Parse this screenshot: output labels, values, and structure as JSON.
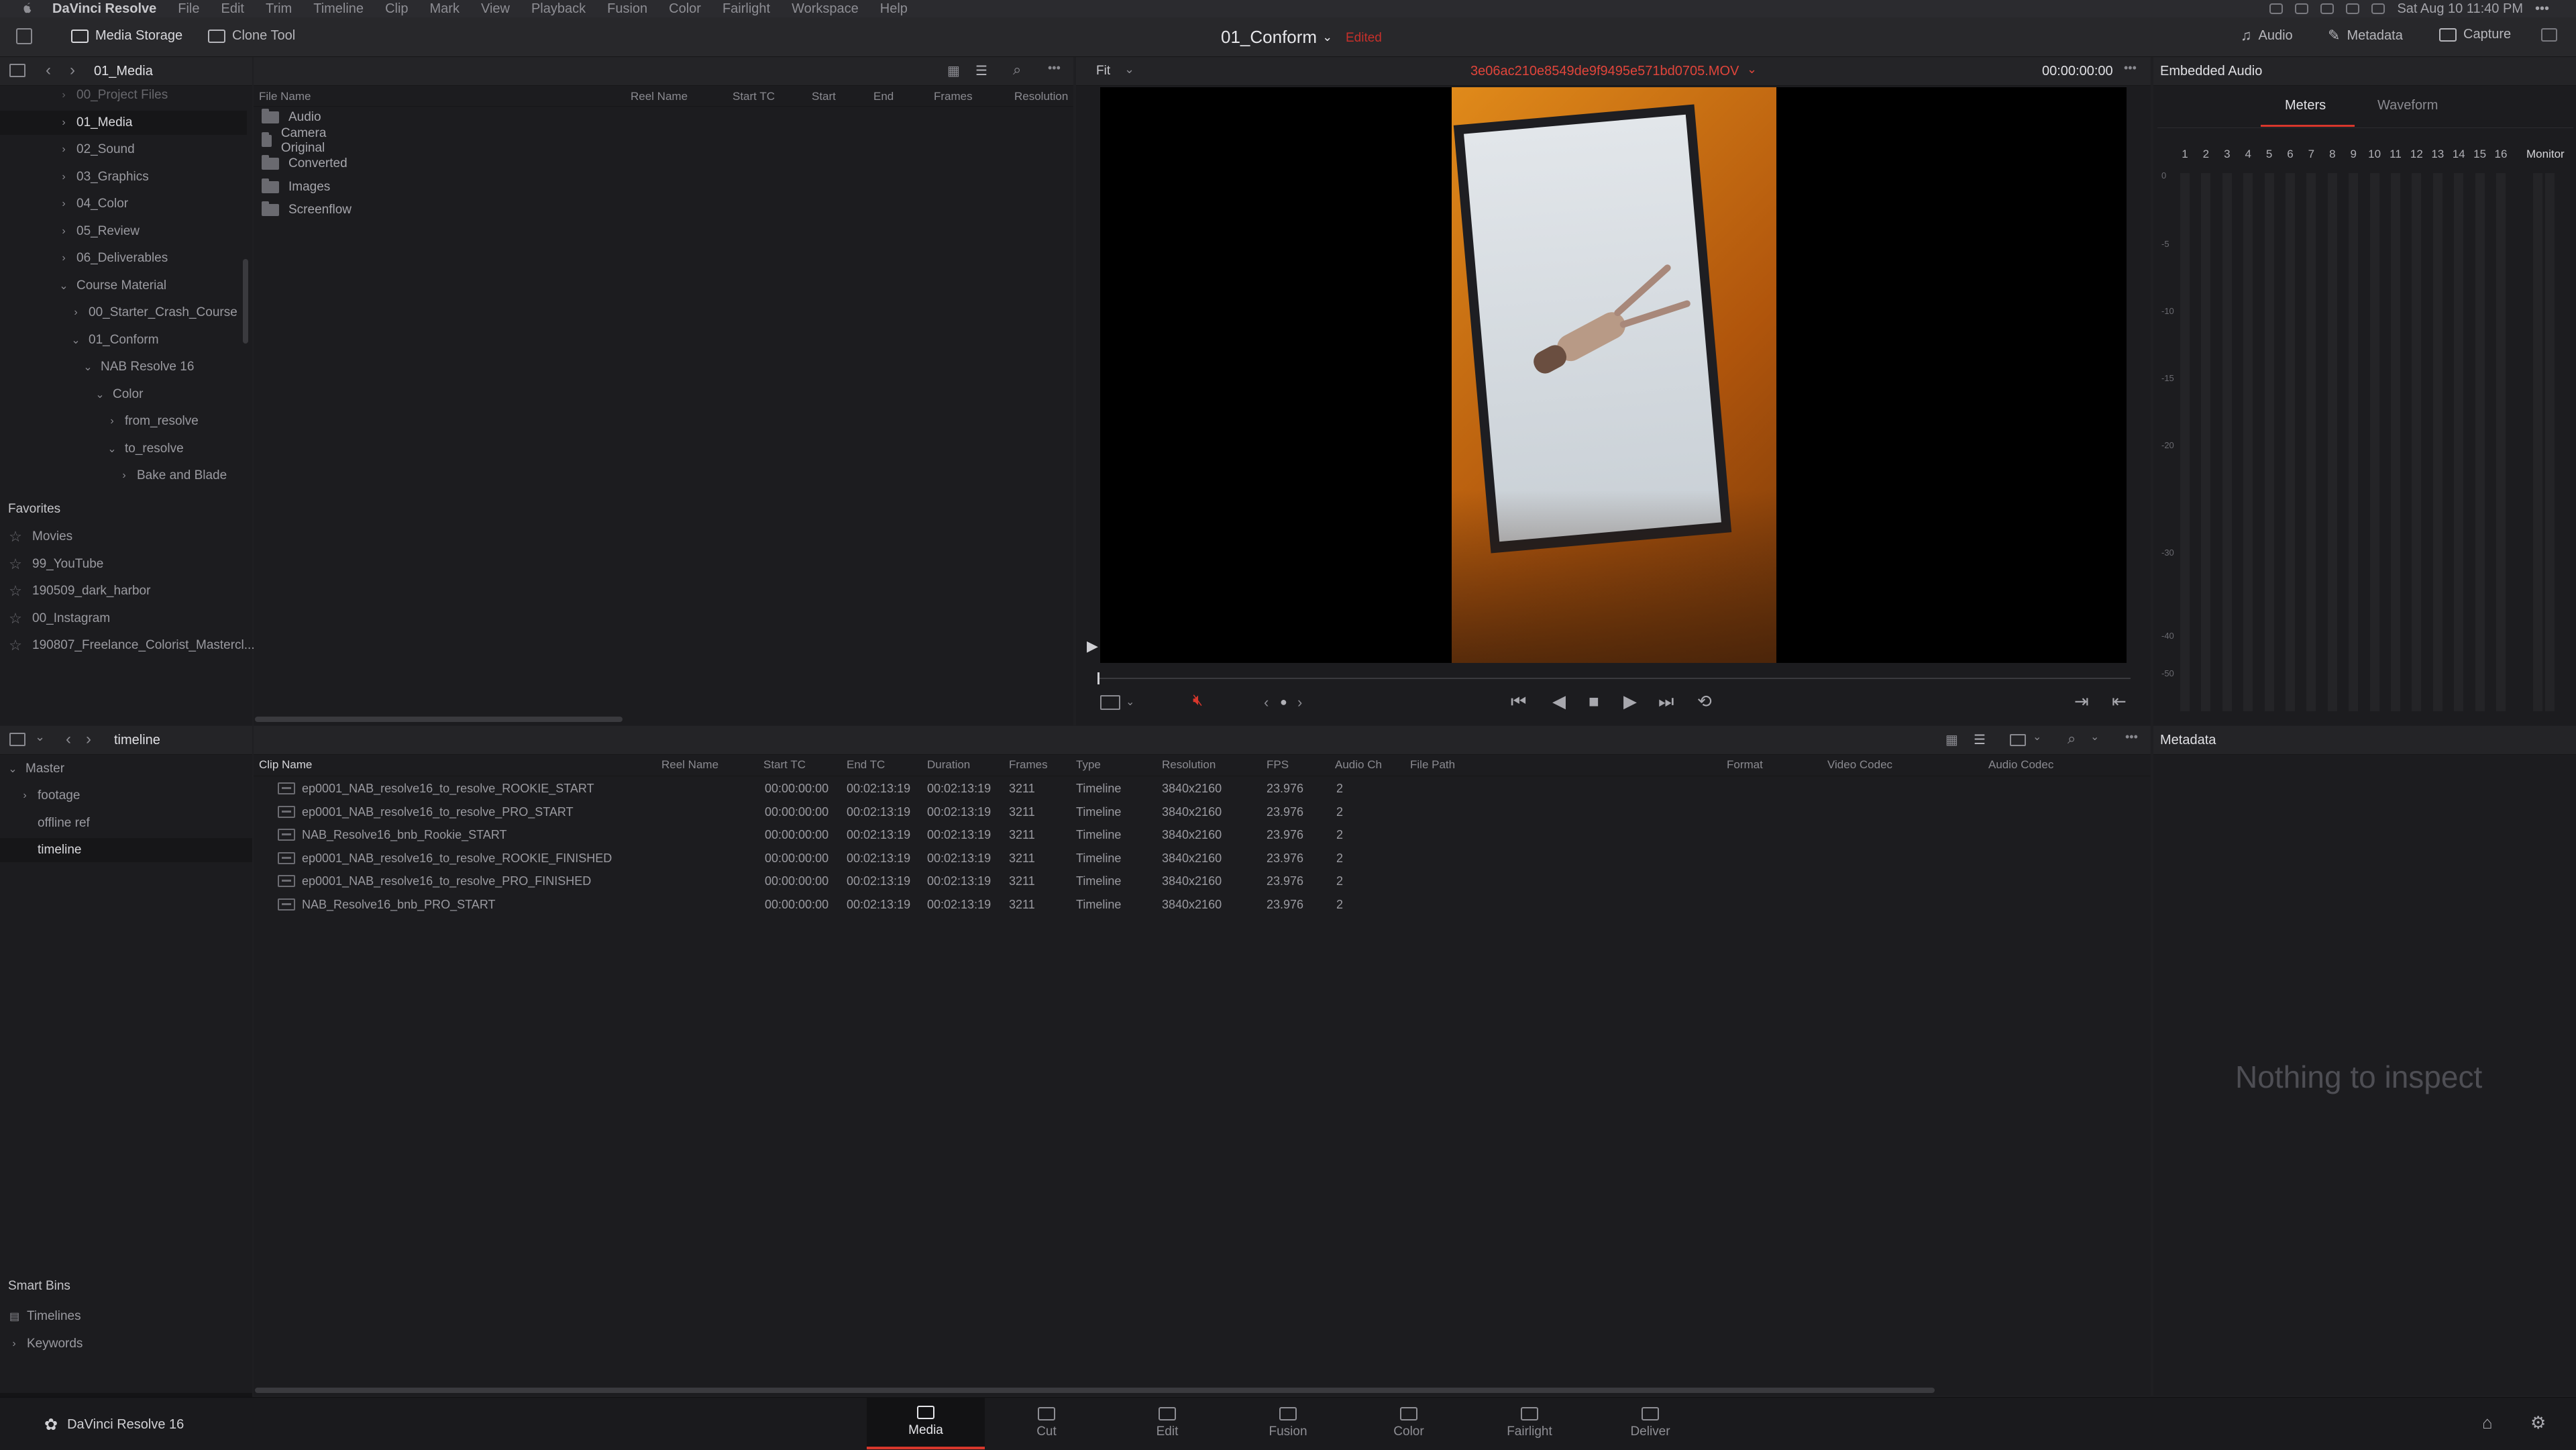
{
  "menubar": {
    "app_name": "DaVinci Resolve",
    "items": [
      "File",
      "Edit",
      "Trim",
      "Timeline",
      "Clip",
      "Mark",
      "View",
      "Playback",
      "Fusion",
      "Color",
      "Fairlight",
      "Workspace",
      "Help"
    ],
    "clock": "Sat Aug 10  11:40 PM"
  },
  "topbar": {
    "media_storage": "Media Storage",
    "clone_tool": "Clone Tool",
    "project_title": "01_Conform",
    "project_status": "Edited",
    "audio": "Audio",
    "metadata": "Metadata",
    "capture": "Capture"
  },
  "media_storage": {
    "path": "01_Media",
    "tree": [
      {
        "label": "00_Project Files",
        "depth": 0,
        "chev": "›",
        "cut": true
      },
      {
        "label": "01_Media",
        "depth": 0,
        "chev": "›",
        "selected": true
      },
      {
        "label": "02_Sound",
        "depth": 0,
        "chev": "›"
      },
      {
        "label": "03_Graphics",
        "depth": 0,
        "chev": "›"
      },
      {
        "label": "04_Color",
        "depth": 0,
        "chev": "›"
      },
      {
        "label": "05_Review",
        "depth": 0,
        "chev": "›"
      },
      {
        "label": "06_Deliverables",
        "depth": 0,
        "chev": "›"
      },
      {
        "label": "Course Material",
        "depth": 0,
        "chev": "⌄"
      },
      {
        "label": "00_Starter_Crash_Course",
        "depth": 1,
        "chev": "›"
      },
      {
        "label": "01_Conform",
        "depth": 1,
        "chev": "⌄"
      },
      {
        "label": "NAB Resolve 16",
        "depth": 2,
        "chev": "⌄"
      },
      {
        "label": "Color",
        "depth": 3,
        "chev": "⌄"
      },
      {
        "label": "from_resolve",
        "depth": 4,
        "chev": "›"
      },
      {
        "label": "to_resolve",
        "depth": 4,
        "chev": "⌄"
      },
      {
        "label": "Bake and Blade",
        "depth": 5,
        "chev": "›"
      }
    ],
    "favorites_title": "Favorites",
    "favorites": [
      "Movies",
      "99_YouTube",
      "190509_dark_harbor",
      "00_Instagram",
      "190807_Freelance_Colorist_Mastercl..."
    ]
  },
  "file_browser": {
    "columns": [
      "File Name",
      "Reel Name",
      "Start TC",
      "Start",
      "End",
      "Frames",
      "Resolution"
    ],
    "folders": [
      "Audio",
      "Camera Original",
      "Converted",
      "Images",
      "Screenflow"
    ]
  },
  "viewer": {
    "zoom": "Fit",
    "clip_name": "3e06ac210e8549de9f9495e571bd0705.MOV",
    "timecode": "00:00:00:00"
  },
  "audio_panel": {
    "title": "Embedded Audio",
    "tabs": [
      "Meters",
      "Waveform"
    ],
    "channels": [
      "1",
      "2",
      "3",
      "4",
      "5",
      "6",
      "7",
      "8",
      "9",
      "10",
      "11",
      "12",
      "13",
      "14",
      "15",
      "16"
    ],
    "monitor": "Monitor",
    "db_scale": [
      "0",
      "-5",
      "-10",
      "-15",
      "-20",
      "-30",
      "-40",
      "-50"
    ]
  },
  "media_pool": {
    "bin_name": "timeline",
    "master": "Master",
    "bins": [
      {
        "label": "footage",
        "chev": "›"
      },
      {
        "label": "offline ref",
        "chev": ""
      },
      {
        "label": "timeline",
        "chev": "",
        "selected": true
      }
    ],
    "smart_bins_title": "Smart Bins",
    "smart_bins": [
      {
        "label": "Timelines",
        "chev": ""
      },
      {
        "label": "Keywords",
        "chev": "›"
      }
    ],
    "columns": [
      "Clip Name",
      "Reel Name",
      "Start TC",
      "End TC",
      "Duration",
      "Frames",
      "Type",
      "Resolution",
      "FPS",
      "Audio Ch",
      "File Path",
      "Format",
      "Video Codec",
      "Audio Codec"
    ],
    "clips": [
      {
        "name": "ep0001_NAB_resolve16_to_resolve_ROOKIE_START",
        "start_tc": "00:00:00:00",
        "end_tc": "00:02:13:19",
        "duration": "00:02:13:19",
        "frames": "3211",
        "type": "Timeline",
        "resolution": "3840x2160",
        "fps": "23.976",
        "audio_ch": "2"
      },
      {
        "name": "ep0001_NAB_resolve16_to_resolve_PRO_START",
        "start_tc": "00:00:00:00",
        "end_tc": "00:02:13:19",
        "duration": "00:02:13:19",
        "frames": "3211",
        "type": "Timeline",
        "resolution": "3840x2160",
        "fps": "23.976",
        "audio_ch": "2"
      },
      {
        "name": "NAB_Resolve16_bnb_Rookie_START",
        "start_tc": "00:00:00:00",
        "end_tc": "00:02:13:19",
        "duration": "00:02:13:19",
        "frames": "3211",
        "type": "Timeline",
        "resolution": "3840x2160",
        "fps": "23.976",
        "audio_ch": "2"
      },
      {
        "name": "ep0001_NAB_resolve16_to_resolve_ROOKIE_FINISHED",
        "start_tc": "00:00:00:00",
        "end_tc": "00:02:13:19",
        "duration": "00:02:13:19",
        "frames": "3211",
        "type": "Timeline",
        "resolution": "3840x2160",
        "fps": "23.976",
        "audio_ch": "2"
      },
      {
        "name": "ep0001_NAB_resolve16_to_resolve_PRO_FINISHED",
        "start_tc": "00:00:00:00",
        "end_tc": "00:02:13:19",
        "duration": "00:02:13:19",
        "frames": "3211",
        "type": "Timeline",
        "resolution": "3840x2160",
        "fps": "23.976",
        "audio_ch": "2"
      },
      {
        "name": "NAB_Resolve16_bnb_PRO_START",
        "start_tc": "00:00:00:00",
        "end_tc": "00:02:13:19",
        "duration": "00:02:13:19",
        "frames": "3211",
        "type": "Timeline",
        "resolution": "3840x2160",
        "fps": "23.976",
        "audio_ch": "2"
      }
    ]
  },
  "metadata_panel": {
    "title": "Metadata",
    "empty_text": "Nothing to inspect"
  },
  "bottom": {
    "brand": "DaVinci Resolve 16",
    "pages": [
      "Media",
      "Cut",
      "Edit",
      "Fusion",
      "Color",
      "Fairlight",
      "Deliver"
    ],
    "active_page": "Media"
  },
  "colors": {
    "accent_red": "#d8372c",
    "edited_red": "#c7302b",
    "clip_name_red": "#e0453b"
  }
}
